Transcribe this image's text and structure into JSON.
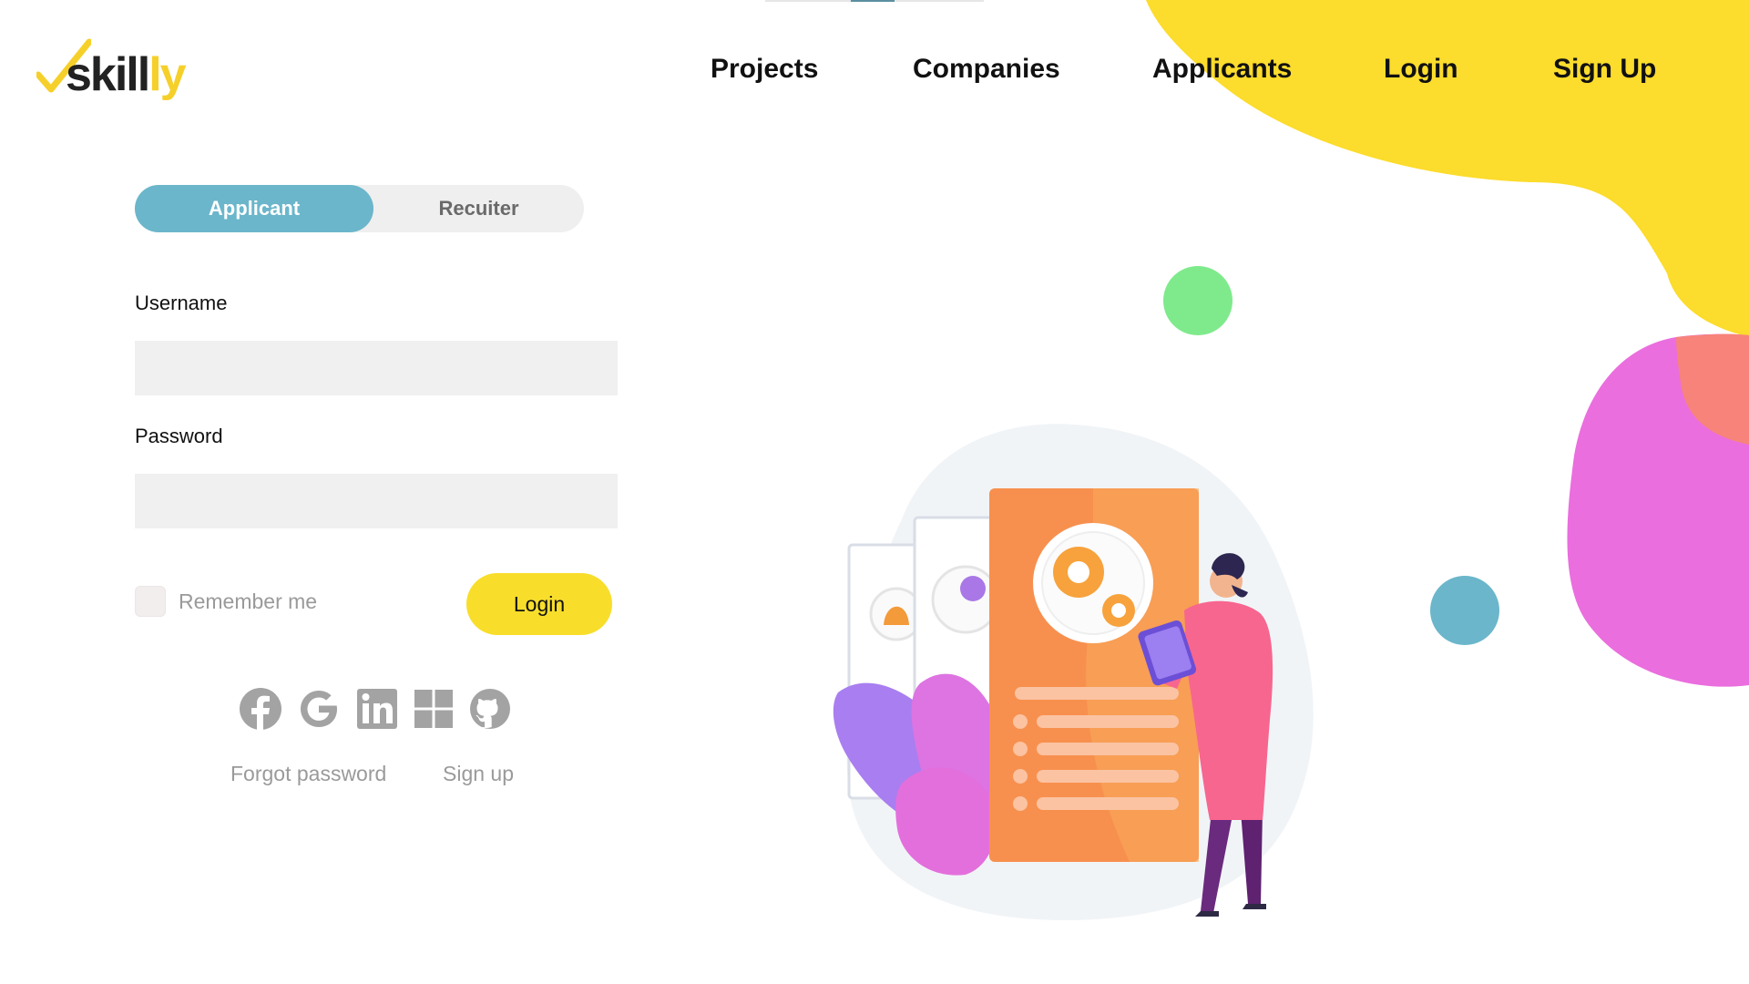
{
  "brand": {
    "logo_main": "skill",
    "logo_accent": "ly",
    "colors": {
      "yellow": "#f8de2b",
      "teal": "#6bb6cb",
      "pink": "#e96be0",
      "green": "#7fe88c"
    }
  },
  "nav": {
    "items": [
      {
        "label": "Projects"
      },
      {
        "label": "Companies"
      },
      {
        "label": "Applicants"
      },
      {
        "label": "Login"
      },
      {
        "label": "Sign Up"
      }
    ]
  },
  "roles": {
    "active": "Applicant",
    "inactive": "Recuiter"
  },
  "form": {
    "username_label": "Username",
    "username_value": "",
    "password_label": "Password",
    "password_value": "",
    "remember_label": "Remember me",
    "remember_checked": false,
    "login_label": "Login"
  },
  "social_icons": [
    "facebook-icon",
    "google-icon",
    "linkedin-icon",
    "windows-icon",
    "github-icon"
  ],
  "links": {
    "forgot": "Forgot password",
    "signup": "Sign up"
  }
}
